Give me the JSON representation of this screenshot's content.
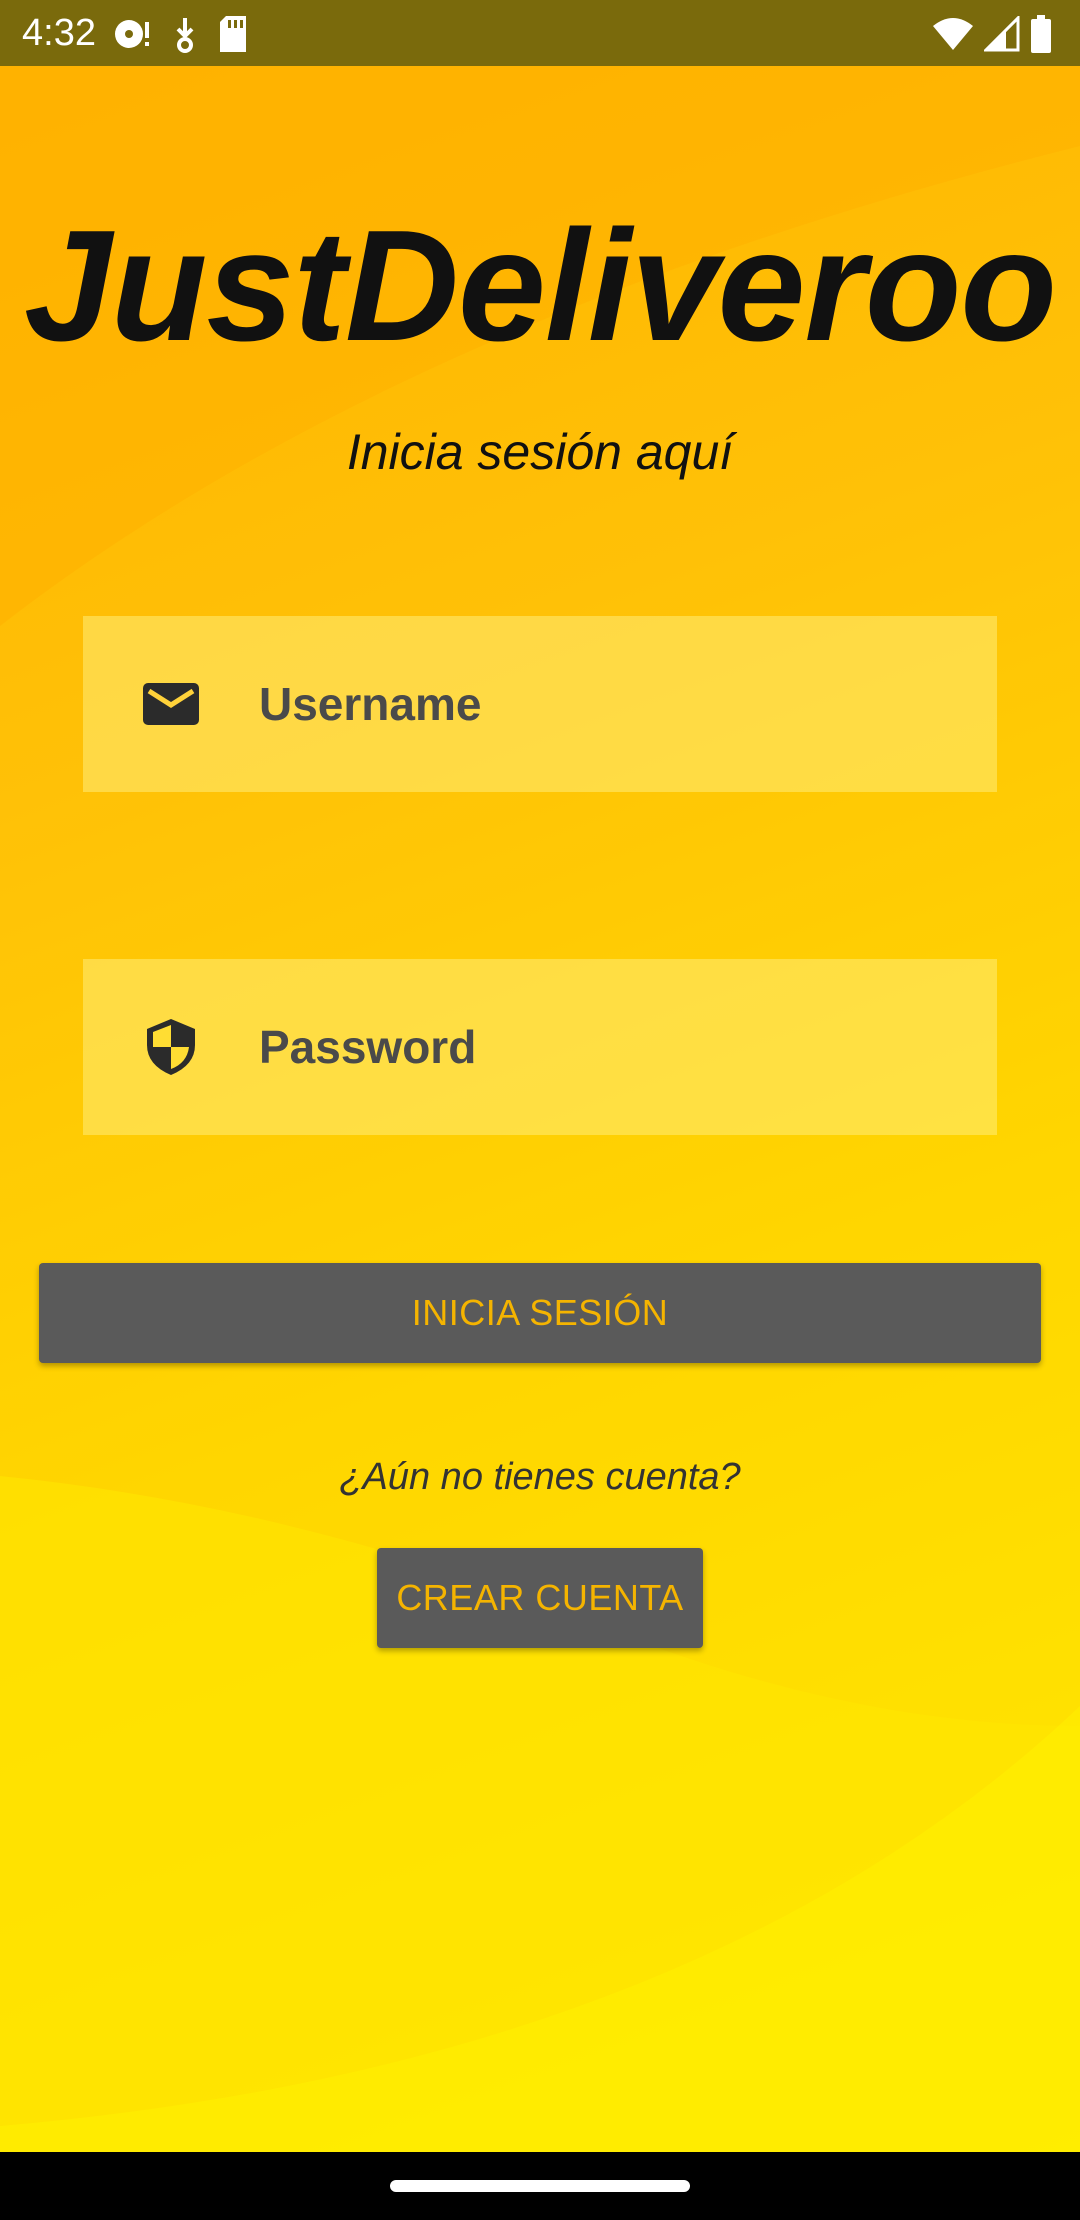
{
  "status_bar": {
    "time": "4:32",
    "left_icons": [
      "media-icon",
      "download-icon",
      "sd-card-icon"
    ],
    "right_icons": [
      "wifi-icon",
      "signal-icon",
      "battery-icon"
    ]
  },
  "app": {
    "title": "JustDeliveroo",
    "subtitle": "Inicia sesión aquí",
    "username": {
      "placeholder": "Username",
      "icon": "email-icon"
    },
    "password": {
      "placeholder": "Password",
      "icon": "shield-icon"
    },
    "login_button": "INICIA SESIÓN",
    "no_account_text": "¿Aún no tienes cuenta?",
    "create_account_button": "CREAR CUENTA"
  },
  "colors": {
    "status_bar": "#7a6a0c",
    "background_top": "#ffb300",
    "background_bottom": "#ffea00",
    "button_bg": "#5a5a5a",
    "button_text": "#f5b400"
  }
}
